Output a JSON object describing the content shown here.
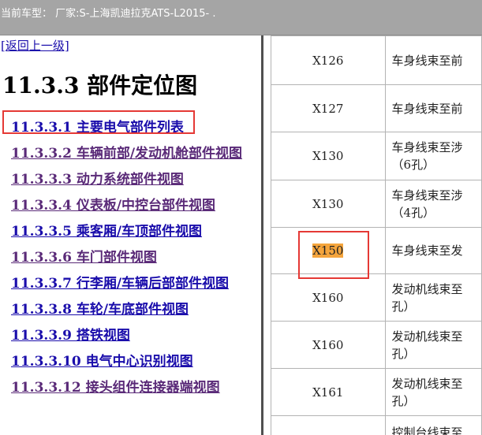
{
  "window": {
    "title": "当前车型：  厂家:S-上海凯迪拉克ATS-L2015-  ."
  },
  "nav": {
    "back_label": "[返回上一级]"
  },
  "page": {
    "heading": "11.3.3 部件定位图"
  },
  "toc": [
    {
      "label": "11.3.3.1 主要电气部件列表",
      "visited": false,
      "highlighted": true
    },
    {
      "label": "11.3.3.2 车辆前部/发动机舱部件视图",
      "visited": true
    },
    {
      "label": "11.3.3.3 动力系统部件视图",
      "visited": true
    },
    {
      "label": "11.3.3.4 仪表板/中控台部件视图",
      "visited": true
    },
    {
      "label": "11.3.3.5 乘客厢/车顶部件视图",
      "visited": false
    },
    {
      "label": "11.3.3.6 车门部件视图",
      "visited": true
    },
    {
      "label": "11.3.3.7 行李厢/车辆后部部件视图",
      "visited": false
    },
    {
      "label": "11.3.3.8 车轮/车底部件视图",
      "visited": false
    },
    {
      "label": "11.3.3.9 搭铁视图",
      "visited": false
    },
    {
      "label": "11.3.3.10 电气中心识别视图",
      "visited": false
    },
    {
      "label": "11.3.3.12 接头组件连接器端视图",
      "visited": true
    }
  ],
  "connector_table": {
    "rows": [
      {
        "code": "X126",
        "desc_line1": "车身线束至前",
        "desc_line2": ""
      },
      {
        "code": "X127",
        "desc_line1": "车身线束至前",
        "desc_line2": ""
      },
      {
        "code": "X130",
        "desc_line1": "车身线束至涉",
        "desc_line2": "（6孔）"
      },
      {
        "code": "X130",
        "desc_line1": "车身线束至涉",
        "desc_line2": "（4孔）"
      },
      {
        "code": "X150",
        "desc_line1": "车身线束至发",
        "desc_line2": "",
        "highlighted": true
      },
      {
        "code": "X160",
        "desc_line1": "发动机线束至",
        "desc_line2": "孔）"
      },
      {
        "code": "X160",
        "desc_line1": "发动机线束至",
        "desc_line2": "孔）"
      },
      {
        "code": "X161",
        "desc_line1": "发动机线束至",
        "desc_line2": "孔）"
      },
      {
        "code": "",
        "desc_line1": "控制台线束至",
        "desc_line2": ""
      }
    ]
  },
  "colors": {
    "annotation_box": "#e53935",
    "text_highlight": "#f5a53d",
    "link": "#1a0dab",
    "visited_link": "#5a2a78"
  }
}
